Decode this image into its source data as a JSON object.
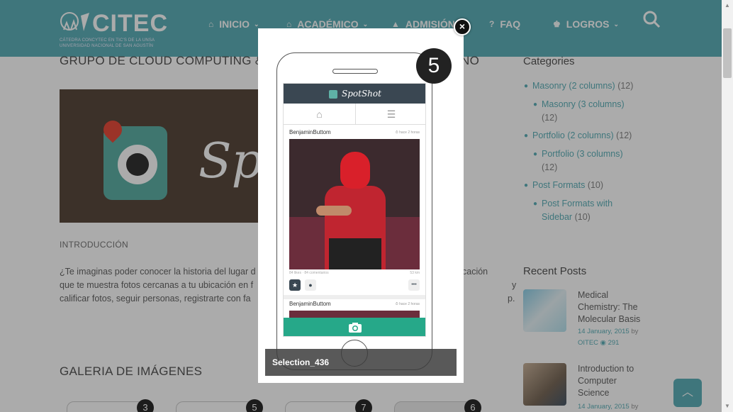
{
  "header": {
    "brand": "CITEC",
    "subtitle_1": "CÁTEDRA CONCYTEC EN TIC'S DE LA UNSA",
    "subtitle_2": "UNIVERSIDAD NACIONAL DE SAN AGUSTÍN",
    "nav": [
      {
        "label": "INICIO",
        "icon": "home-icon",
        "has_caret": true
      },
      {
        "label": "ACADÉMICO",
        "icon": "university-icon",
        "has_caret": true
      },
      {
        "label": "ADMISIÓN",
        "icon": "graduation-cap-icon",
        "has_caret": true
      },
      {
        "label": "FAQ",
        "icon": "question-circle-icon",
        "has_caret": false
      },
      {
        "label": "LOGROS",
        "icon": "trophy-icon",
        "has_caret": true
      }
    ],
    "caret": "⌄"
  },
  "article": {
    "title": "GRUPO DE CLOUD COMPUTING & C",
    "title_tail": "NO",
    "image_text": "Sp",
    "intro_heading": "INTRODUCCIÓN",
    "intro_lines": [
      "¿Te imaginas poder conocer la historia del lugar d",
      "que te muestra fotos cercanas a tu ubicación en f",
      "calificar fotos, seguir personas, registrarte con fa"
    ],
    "intro_lines_right": [
      "cación",
      "y",
      "p."
    ],
    "gallery_heading": "GALERIA DE IMÁGENES",
    "gallery_badges": [
      "3",
      "5",
      "7",
      "6"
    ]
  },
  "sidebar": {
    "categories_heading": "Categories",
    "categories": [
      {
        "name": "Masonry (2 columns)",
        "count": "(12)",
        "sub": false
      },
      {
        "name": "Masonry (3 columns)",
        "count": "(12)",
        "sub": true
      },
      {
        "name": "Portfolio (2 columns)",
        "count": "(12)",
        "sub": false
      },
      {
        "name": "Portfolio (3 columns)",
        "count": "(12)",
        "sub": true
      },
      {
        "name": "Post Formats",
        "count": "(10)",
        "sub": false
      },
      {
        "name": "Post Formats with Sidebar",
        "count": "(10)",
        "sub": true
      }
    ],
    "recent_heading": "Recent Posts",
    "recent_posts": [
      {
        "title": "Medical Chemistry: The Molecular Basis",
        "date": "14 January, 2015",
        "by": "by",
        "author": "OITEC",
        "views": "291"
      },
      {
        "title": "Introduction to Computer Science",
        "date": "14 January, 2015",
        "by": "by"
      }
    ]
  },
  "lightbox": {
    "badge": "5",
    "caption": "Selection_436",
    "close": "×",
    "app_name": "SpotShot",
    "feed_user": "BenjaminButtom",
    "feed_time": "⏱ hace 2 horas",
    "feed_stats": "84 likes · 84 comentarios",
    "feed_distance": "53 km",
    "feed_user_2": "BenjaminButtom",
    "feed_time_2": "⏱ hace 2 horas",
    "more": "•••"
  },
  "scroll_to_top_icon": "chevron-up-icon",
  "colors": {
    "header": "#5fb1b9",
    "accent": "#5fb1b9",
    "overlay": "rgba(0,0,0,0.33)"
  }
}
